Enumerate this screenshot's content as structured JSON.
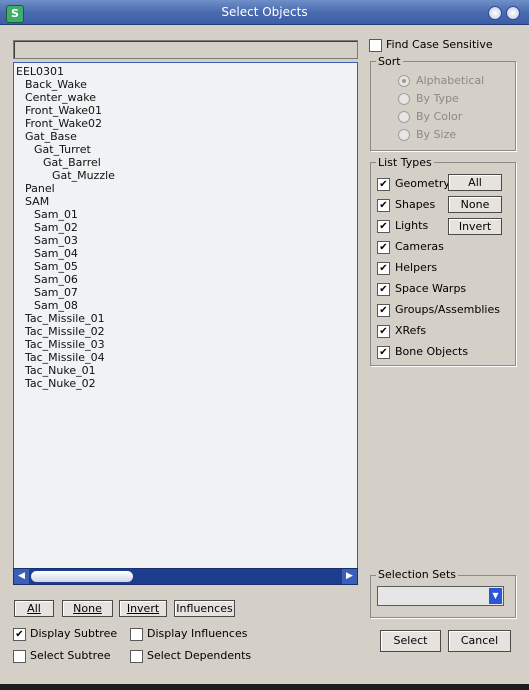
{
  "window": {
    "title": "Select Objects"
  },
  "search": {
    "value": ""
  },
  "find_case_sensitive": {
    "label": "Find Case Sensitive",
    "checked": false
  },
  "objects": [
    {
      "name": "EEL0301",
      "depth": 0
    },
    {
      "name": "Back_Wake",
      "depth": 1
    },
    {
      "name": "Center_wake",
      "depth": 1
    },
    {
      "name": "Front_Wake01",
      "depth": 1
    },
    {
      "name": "Front_Wake02",
      "depth": 1
    },
    {
      "name": "Gat_Base",
      "depth": 1
    },
    {
      "name": "Gat_Turret",
      "depth": 2
    },
    {
      "name": "Gat_Barrel",
      "depth": 3
    },
    {
      "name": "Gat_Muzzle",
      "depth": 4
    },
    {
      "name": "Panel",
      "depth": 1
    },
    {
      "name": "SAM",
      "depth": 1
    },
    {
      "name": "Sam_01",
      "depth": 2
    },
    {
      "name": "Sam_02",
      "depth": 2
    },
    {
      "name": "Sam_03",
      "depth": 2
    },
    {
      "name": "Sam_04",
      "depth": 2
    },
    {
      "name": "Sam_05",
      "depth": 2
    },
    {
      "name": "Sam_06",
      "depth": 2
    },
    {
      "name": "Sam_07",
      "depth": 2
    },
    {
      "name": "Sam_08",
      "depth": 2
    },
    {
      "name": "Tac_Missile_01",
      "depth": 1
    },
    {
      "name": "Tac_Missile_02",
      "depth": 1
    },
    {
      "name": "Tac_Missile_03",
      "depth": 1
    },
    {
      "name": "Tac_Missile_04",
      "depth": 1
    },
    {
      "name": "Tac_Nuke_01",
      "depth": 1
    },
    {
      "name": "Tac_Nuke_02",
      "depth": 1
    }
  ],
  "sort": {
    "title": "Sort",
    "options": [
      "Alphabetical",
      "By Type",
      "By Color",
      "By Size"
    ],
    "selected": "Alphabetical"
  },
  "list_types": {
    "title": "List Types",
    "items": [
      "Geometry",
      "Shapes",
      "Lights",
      "Cameras",
      "Helpers",
      "Space Warps",
      "Groups/Assemblies",
      "XRefs",
      "Bone Objects"
    ],
    "buttons": {
      "all": "All",
      "none": "None",
      "invert": "Invert"
    }
  },
  "list_buttons": {
    "all": "All",
    "none": "None",
    "invert": "Invert",
    "influences": "Influences"
  },
  "options": {
    "display_subtree": {
      "label": "Display Subtree",
      "checked": true
    },
    "select_subtree": {
      "label": "Select Subtree",
      "checked": false
    },
    "display_influences": {
      "label": "Display Influences",
      "checked": false
    },
    "select_dependents": {
      "label": "Select Dependents",
      "checked": false
    }
  },
  "selection_sets": {
    "title": "Selection Sets",
    "value": ""
  },
  "actions": {
    "select": "Select",
    "cancel": "Cancel"
  }
}
